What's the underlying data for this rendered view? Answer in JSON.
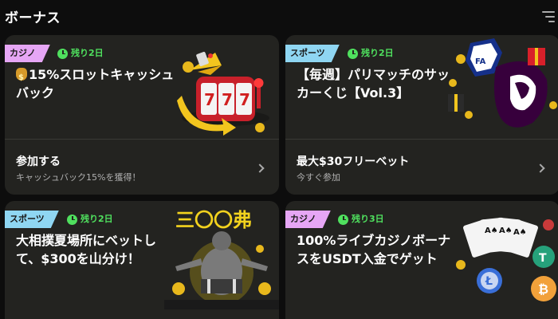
{
  "header": {
    "title": "ボーナス"
  },
  "cards": [
    {
      "category": "カジノ",
      "days_left": "残り2日",
      "title": "15%スロットキャッシュバック",
      "cta": "参加する",
      "cta_sub": "キャッシュバック15%を獲得！"
    },
    {
      "category": "スポーツ",
      "days_left": "残り2日",
      "title": "【毎週】パリマッチのサッカーくじ【Vol.3】",
      "cta": "最大$30フリーベット",
      "cta_sub": "今すぐ参加"
    },
    {
      "category": "スポーツ",
      "days_left": "残り2日",
      "title": "大相撲夏場所にベットして、$300を山分け！",
      "art_text": "三〇〇弗"
    },
    {
      "category": "カジノ",
      "days_left": "残り3日",
      "title": "100%ライブカジノボーナスをUSDT入金でゲット"
    }
  ],
  "colors": {
    "casino_tag": "#e6a6f5",
    "sports_tag": "#8fd6f2",
    "days_green": "#4fe05e",
    "card_bg": "#232320"
  }
}
